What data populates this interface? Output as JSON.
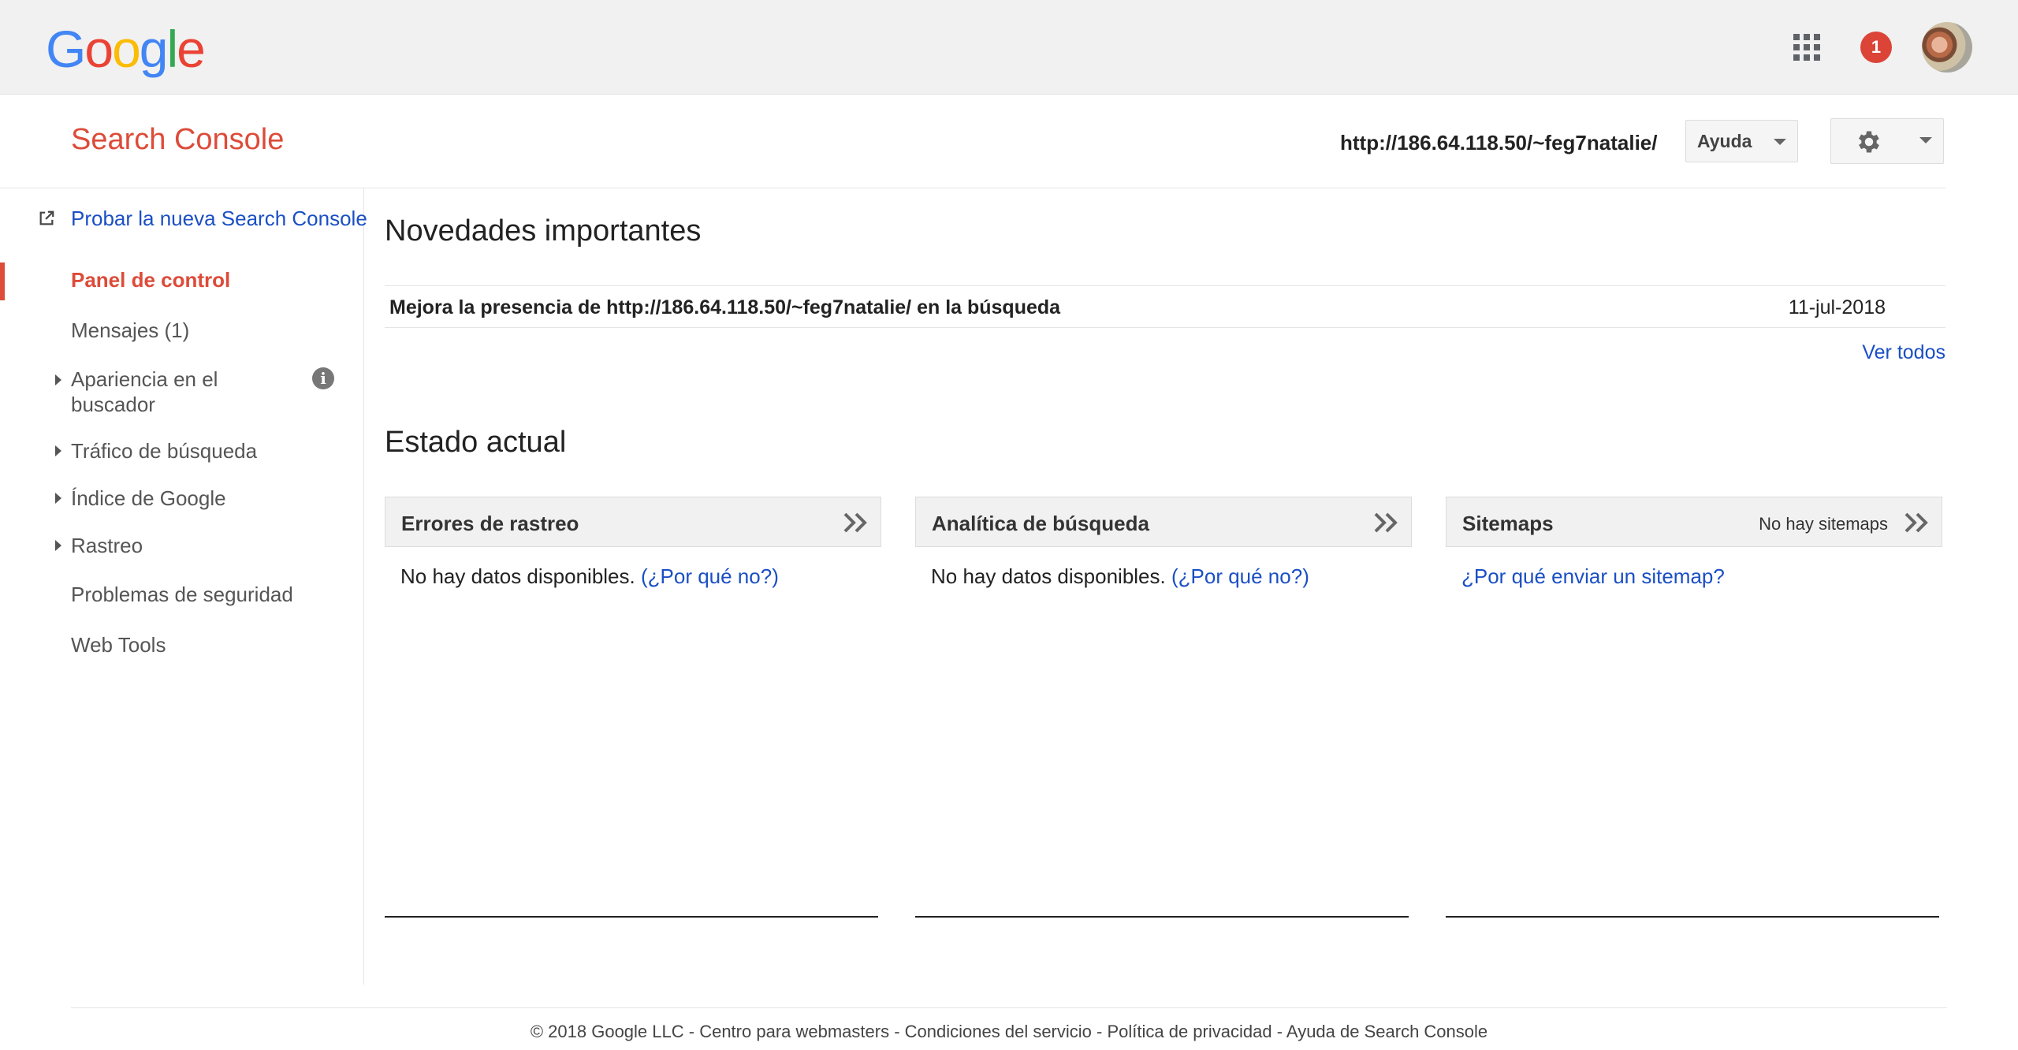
{
  "topbar": {
    "logo_letters": [
      {
        "ch": "G",
        "color": "#4285F4"
      },
      {
        "ch": "o",
        "color": "#EA4335"
      },
      {
        "ch": "o",
        "color": "#FBBC05"
      },
      {
        "ch": "g",
        "color": "#4285F4"
      },
      {
        "ch": "l",
        "color": "#34A853"
      },
      {
        "ch": "e",
        "color": "#EA4335"
      }
    ],
    "notification_count": "1",
    "icons": [
      "apps-grid-icon",
      "notifications-badge",
      "avatar"
    ]
  },
  "header": {
    "app_title": "Search Console",
    "site_url": "http://186.64.118.50/~feg7natalie/",
    "help_label": "Ayuda",
    "settings_icon": "gear-icon"
  },
  "sidebar": {
    "try_new": "Probar la nueva Search Console",
    "items": [
      {
        "label": "Panel de control",
        "active": true,
        "expandable": false
      },
      {
        "label": "Mensajes (1)",
        "active": false,
        "expandable": false
      },
      {
        "label": "Apariencia en el",
        "label_line2": "buscador",
        "active": false,
        "expandable": true,
        "info": true
      },
      {
        "label": "Tráfico de búsqueda",
        "active": false,
        "expandable": true
      },
      {
        "label": "Índice de Google",
        "active": false,
        "expandable": true
      },
      {
        "label": "Rastreo",
        "active": false,
        "expandable": true
      },
      {
        "label": "Problemas de seguridad",
        "active": false,
        "expandable": false
      },
      {
        "label": "Web Tools",
        "active": false,
        "expandable": false
      }
    ]
  },
  "main": {
    "news_heading": "Novedades importantes",
    "news": [
      {
        "text": "Mejora la presencia de http://186.64.118.50/~feg7natalie/ en la búsqueda",
        "date": "11-jul-2018"
      }
    ],
    "view_all": "Ver todos",
    "status_heading": "Estado actual",
    "cards": [
      {
        "title": "Errores de rastreo",
        "meta": "",
        "body": "No hay datos disponibles.",
        "link": "(¿Por qué no?)"
      },
      {
        "title": "Analítica de búsqueda",
        "meta": "",
        "body": "No hay datos disponibles.",
        "link": "(¿Por qué no?)"
      },
      {
        "title": "Sitemaps",
        "meta": "No hay sitemaps",
        "body": "",
        "link": "¿Por qué enviar un sitemap?"
      }
    ]
  },
  "footer": {
    "copyright": "© 2018 Google LLC",
    "links": [
      "Centro para webmasters",
      "Condiciones del servicio",
      "Política de privacidad",
      "Ayuda de Search Console"
    ],
    "separator": " - "
  },
  "colors": {
    "accent_red": "#dd4b39",
    "link_blue": "#1a4fc4",
    "topbar_bg": "#f1f1f1"
  }
}
